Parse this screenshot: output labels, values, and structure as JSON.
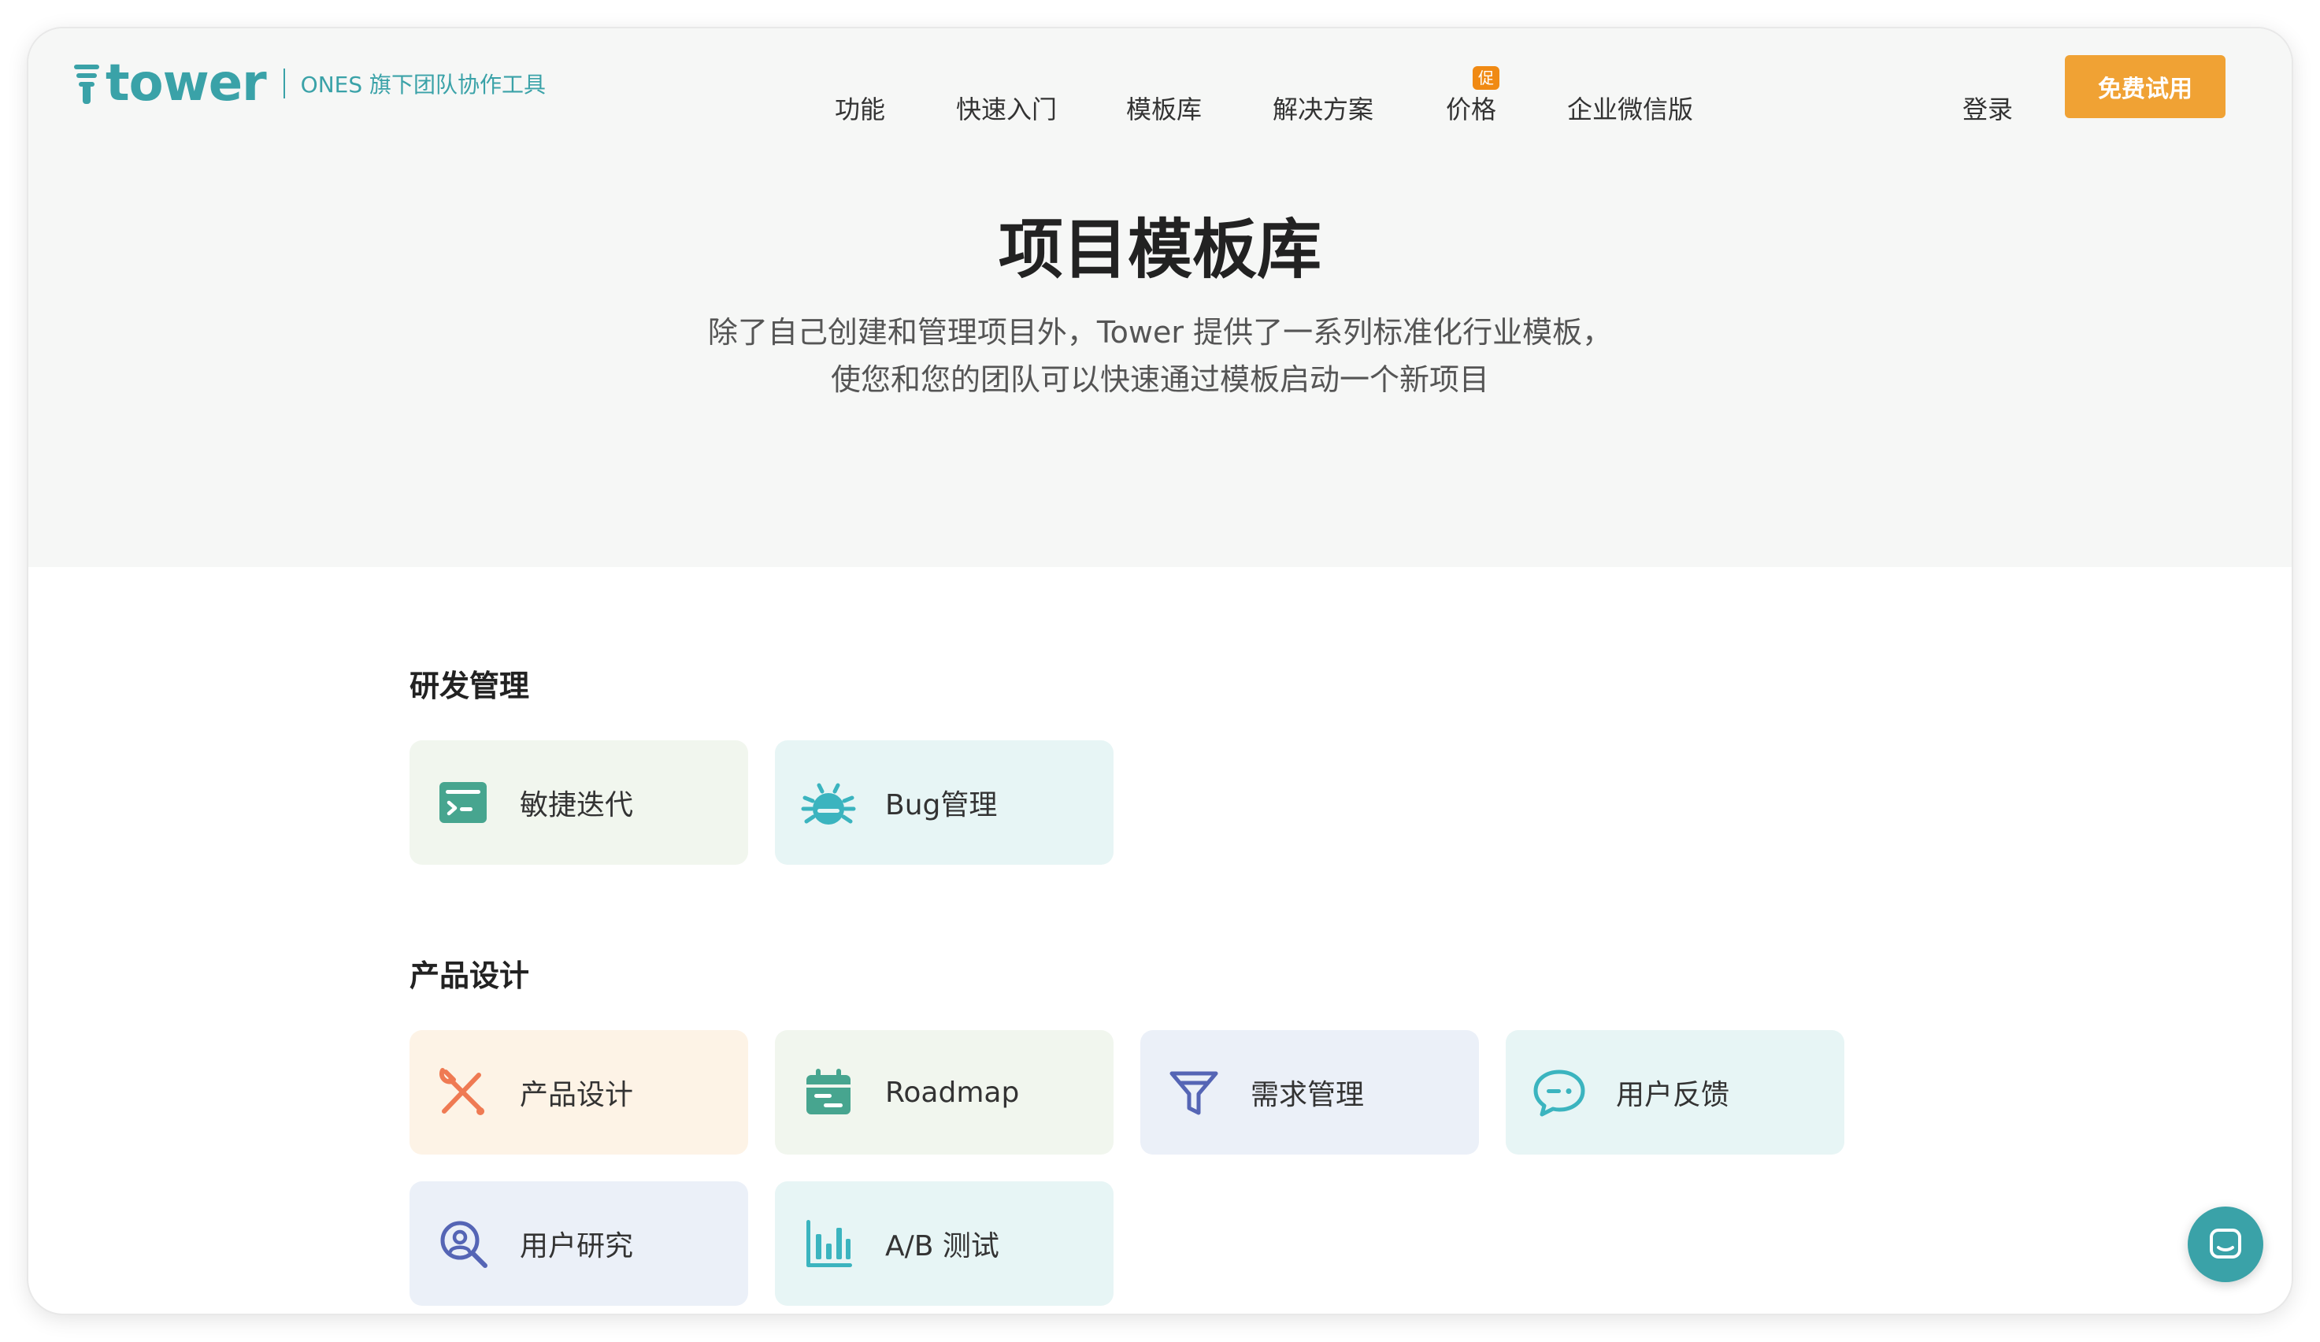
{
  "header": {
    "logo_text": "tower",
    "logo_subtitle": "ONES 旗下团队协作工具",
    "nav": [
      {
        "label": "功能"
      },
      {
        "label": "快速入门"
      },
      {
        "label": "模板库"
      },
      {
        "label": "解决方案"
      },
      {
        "label": "价格"
      },
      {
        "label": "企业微信版"
      }
    ],
    "promo_badge": "促",
    "login": "登录",
    "trial": "免费试用"
  },
  "hero": {
    "title": "项目模板库",
    "desc_line1": "除了自己创建和管理项目外，Tower 提供了一系列标准化行业模板，",
    "desc_line2": "使您和您的团队可以快速通过模板启动一个新项目"
  },
  "sections": [
    {
      "title": "研发管理",
      "cards": [
        {
          "label": "敏捷迭代",
          "icon": "terminal-icon"
        },
        {
          "label": "Bug管理",
          "icon": "bug-icon"
        }
      ]
    },
    {
      "title": "产品设计",
      "cards": [
        {
          "label": "产品设计",
          "icon": "design-tools-icon"
        },
        {
          "label": "Roadmap",
          "icon": "calendar-icon"
        },
        {
          "label": "需求管理",
          "icon": "funnel-icon"
        },
        {
          "label": "用户反馈",
          "icon": "chat-bubble-icon"
        },
        {
          "label": "用户研究",
          "icon": "user-search-icon"
        },
        {
          "label": "A/B 测试",
          "icon": "bar-chart-icon"
        }
      ]
    }
  ],
  "colors": {
    "brand": "#3aa2a8",
    "cta": "#f0a234",
    "promo": "#f08a14",
    "hero_bg": "#f6f7f6"
  }
}
